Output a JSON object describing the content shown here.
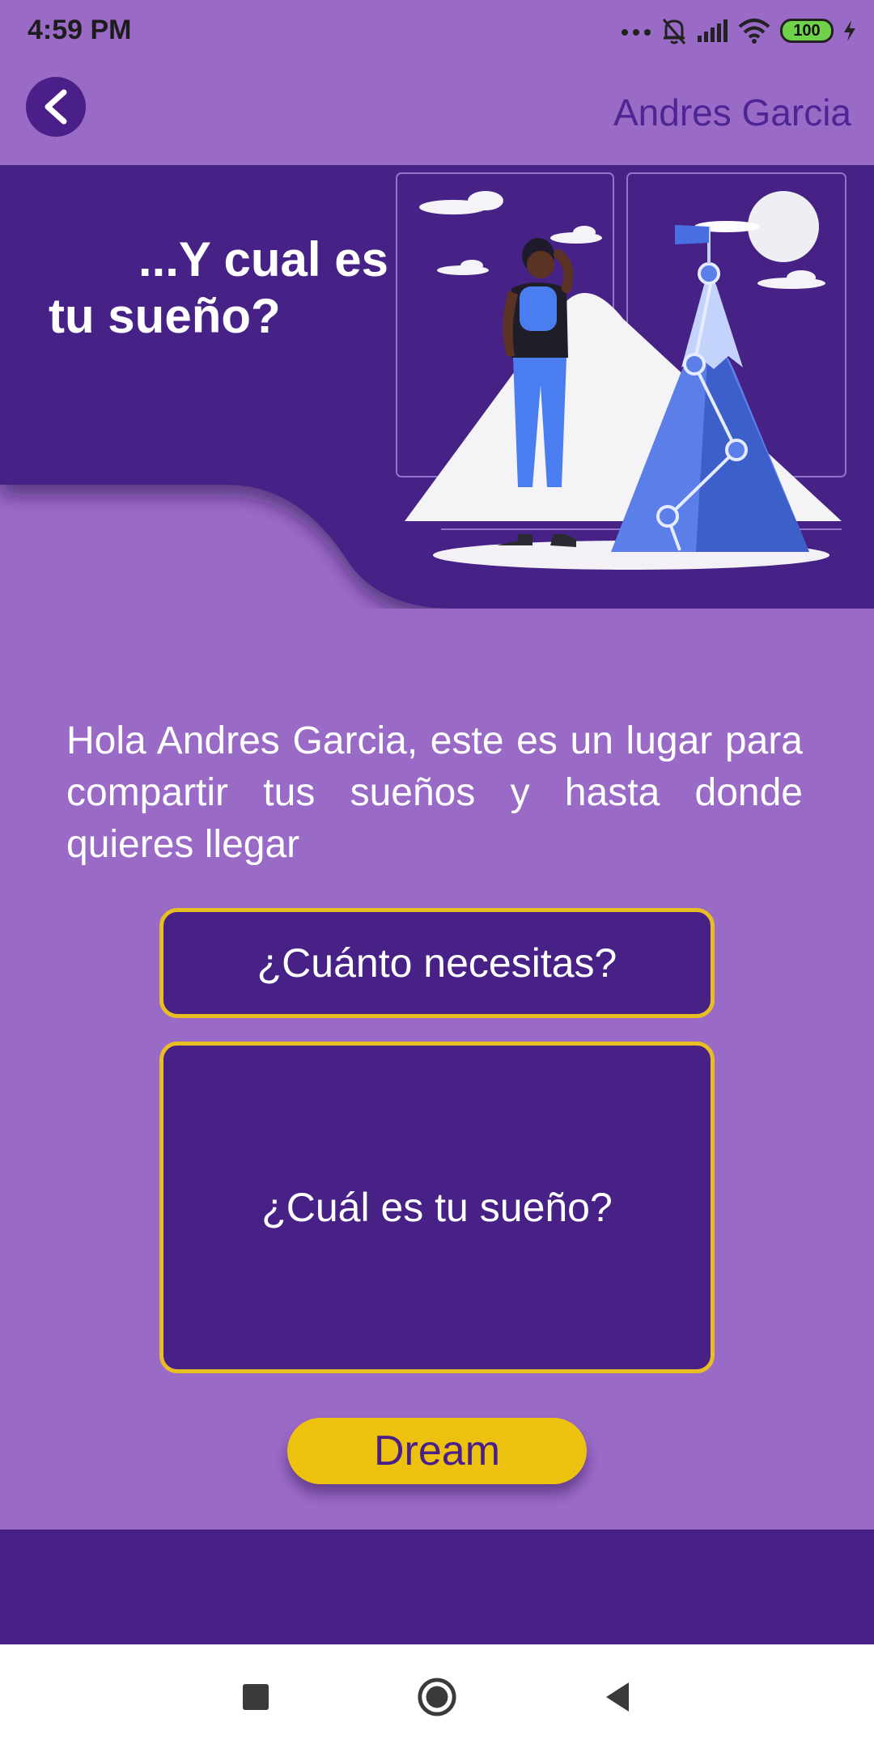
{
  "status_bar": {
    "time": "4:59 PM",
    "battery": "100"
  },
  "header": {
    "user_name": "Andres Garcia"
  },
  "hero": {
    "title_line1": "...Y cual es",
    "title_line2": "tu sueño?"
  },
  "main": {
    "message": "Hola Andres Garcia, este es un lugar para compartir tus sueños y hasta donde quieres llegar",
    "amount_label": "¿Cuánto necesitas?",
    "dream_label": "¿Cuál es tu sueño?",
    "submit_label": "Dream"
  },
  "colors": {
    "background": "#9a6ac7",
    "primary": "#472186",
    "accent": "#edc20e",
    "border": "#e8be23"
  },
  "icons": {
    "back": "chevron-left-icon",
    "nav_recents": "square-icon",
    "nav_home": "circle-icon",
    "nav_back": "triangle-left-icon"
  }
}
